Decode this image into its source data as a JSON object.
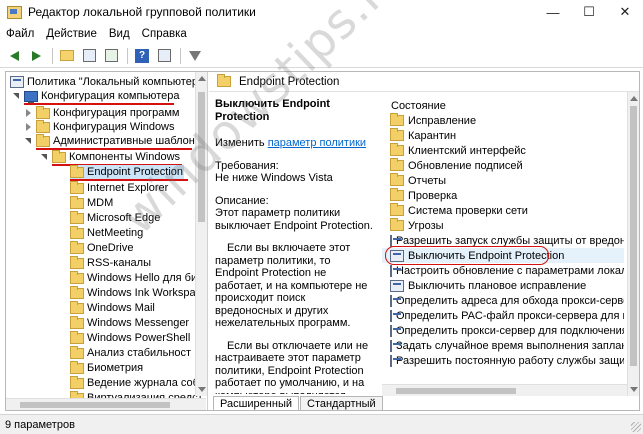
{
  "window": {
    "title": "Редактор локальной групповой политики",
    "minimize": "—",
    "maximize": "☐",
    "close": "✕"
  },
  "menu": [
    "Файл",
    "Действие",
    "Вид",
    "Справка"
  ],
  "toolbar": {
    "icons": [
      "back-icon",
      "forward-icon",
      "folder-up-icon",
      "show-hide-tree-icon",
      "export-icon",
      "help-icon",
      "properties-icon",
      "filter-icon"
    ]
  },
  "tree": {
    "root": "Политика \"Локальный компьютер\"",
    "computer_config": "Конфигурация компьютера",
    "software_config": "Конфигурация программ",
    "windows_config": "Конфигурация Windows",
    "admin_templates": "Административные шаблоны",
    "windows_components": "Компоненты Windows",
    "items": [
      "Endpoint Protection",
      "Internet Explorer",
      "MDM",
      "Microsoft Edge",
      "NetMeeting",
      "OneDrive",
      "RSS-каналы",
      "Windows Hello для биз",
      "Windows Ink Workspac",
      "Windows Mail",
      "Windows Messenger",
      "Windows PowerShell",
      "Анализ стабильност",
      "Биометрия",
      "Ведение журнала соб",
      "Виртуализация средст"
    ]
  },
  "right_header": "Endpoint Protection",
  "description": {
    "title": "Выключить Endpoint Protection",
    "edit_prefix": "Изменить ",
    "edit_link": "параметр политики",
    "requirements_label": "Требования:",
    "requirements": "Не ниже Windows Vista",
    "description_label": "Описание:",
    "description": "Этот параметр политики выключает Endpoint Protection.",
    "para_enable": "Если вы включаете этот параметр политики, то Endpoint Protection не работает, и на компьютере не происходит поиск вредоносных и других нежелательных программ.",
    "para_disable": "Если вы отключаете или не настраиваете этот параметр политики, Endpoint Protection работает по умолчанию, и на компьютере выполняется поиск вредоносных и других"
  },
  "list": {
    "header": "Состояние",
    "folders": [
      "Исправление",
      "Карантин",
      "Клиентский интерфейс",
      "Обновление подписей",
      "Отчеты",
      "Проверка",
      "Система проверки сети",
      "Угрозы"
    ],
    "settings": [
      "Разрешить запуск службы защиты от вредоносн",
      "Выключить Endpoint Protection",
      "Настроить обновление с параметрами локально",
      "Выключить плановое исправление",
      "Определить адреса для обхода прокси-сервера",
      "Определить PAC-файл прокси-сервера для подкл",
      "Определить прокси-сервер для подключения к с",
      "Задать случайное время выполнения запланиров",
      "Разрешить постоянную работу службы защиты с"
    ]
  },
  "tabs": [
    "Расширенный",
    "Стандартный"
  ],
  "status": "9 параметров",
  "watermark": "windowstips.ru"
}
